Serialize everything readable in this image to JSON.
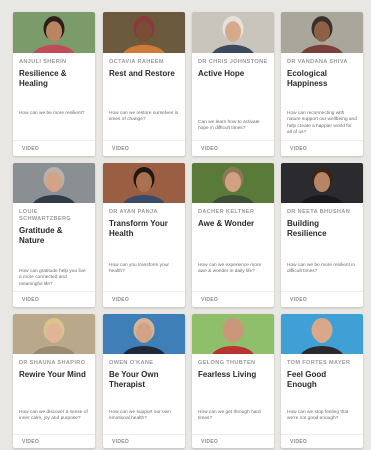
{
  "cards": [
    {
      "name": "ANJULI SHERIN",
      "title": "Resilience & Healing",
      "question": "How can we be more resilient?",
      "tag": "VIDEO",
      "photo": {
        "bg": "#7c9b6a",
        "skin": "#b98563",
        "hair": "#2d1f18",
        "shirt": "#c24b5a"
      }
    },
    {
      "name": "OCTAVIA RAHEEM",
      "title": "Rest and Restore",
      "question": "How can we restore ourselves in times of change?",
      "tag": "VIDEO",
      "photo": {
        "bg": "#6b5a3e",
        "skin": "#7a4d35",
        "hair": "#8a3a3a",
        "shirt": "#d07a3a"
      }
    },
    {
      "name": "DR CHRIS JOHNSTONE",
      "title": "Active Hope",
      "question": "Can we learn how to activate hope in difficult times?",
      "tag": "VIDEO",
      "photo": {
        "bg": "#c9c5bd",
        "skin": "#d6a98a",
        "hair": "#e5e2dc",
        "shirt": "#3c4a5e"
      }
    },
    {
      "name": "DR VANDANA SHIVA",
      "title": "Ecological Happiness",
      "question": "How can reconnecting with nature support our wellbeing and help create a happier world for all of us?",
      "tag": "VIDEO",
      "photo": {
        "bg": "#a9a79b",
        "skin": "#8e6046",
        "hair": "#3a302a",
        "shirt": "#7b3f3a"
      }
    },
    {
      "name": "LOUIE SCHWARTZBERG",
      "title": "Gratitude & Nature",
      "question": "How can gratitude help you live a more connected and meaningful life?",
      "tag": "VIDEO",
      "photo": {
        "bg": "#8a8f93",
        "skin": "#d3a387",
        "hair": "#b7b2aa",
        "shirt": "#2f3b47"
      }
    },
    {
      "name": "DR AYAN PANJA",
      "title": "Transform Your Health",
      "question": "How can you transform your health?",
      "tag": "VIDEO",
      "photo": {
        "bg": "#9a5f43",
        "skin": "#a9714f",
        "hair": "#1e1712",
        "shirt": "#3a4a6a"
      }
    },
    {
      "name": "DACHER KELTNER",
      "title": "Awe & Wonder",
      "question": "How can we experience more awe & wonder in daily life?",
      "tag": "VIDEO",
      "photo": {
        "bg": "#5a7a3a",
        "skin": "#d2a182",
        "hair": "#8a7a5a",
        "shirt": "#3e4d35"
      }
    },
    {
      "name": "DR NEETA BHUSHAN",
      "title": "Building Resilience",
      "question": "How can we be more resilient in difficult times?",
      "tag": "VIDEO",
      "photo": {
        "bg": "#2b2b2f",
        "skin": "#b88466",
        "hair": "#3a2418",
        "shirt": "#1a1a1a"
      }
    },
    {
      "name": "DR SHAUNA SHAPIRO",
      "title": "Rewire Your Mind",
      "question": "How can we discover a sense of inner calm, joy and purpose?",
      "tag": "VIDEO",
      "photo": {
        "bg": "#b9a98a",
        "skin": "#e0b597",
        "hair": "#d9c48a",
        "shirt": "#9a8a70"
      }
    },
    {
      "name": "OWEN O'KANE",
      "title": "Be Your Own Therapist",
      "question": "How can we support our own emotional health?",
      "tag": "VIDEO",
      "photo": {
        "bg": "#3f7fb8",
        "skin": "#d2a284",
        "hair": "#d6b49a",
        "shirt": "#1f2a38"
      }
    },
    {
      "name": "GELONG THUBTEN",
      "title": "Fearless Living",
      "question": "How can we get through hard times?",
      "tag": "VIDEO",
      "photo": {
        "bg": "#8fbf6a",
        "skin": "#c99878",
        "hair": "#c99878",
        "shirt": "#b8342f"
      }
    },
    {
      "name": "TOM FORTES MAYER",
      "title": "Feel Good Enough",
      "question": "How can we stop feeling that we're not good enough?",
      "tag": "VIDEO",
      "photo": {
        "bg": "#3fa0d6",
        "skin": "#d9a888",
        "hair": "#d9a888",
        "shirt": "#2a2a2a"
      }
    }
  ]
}
